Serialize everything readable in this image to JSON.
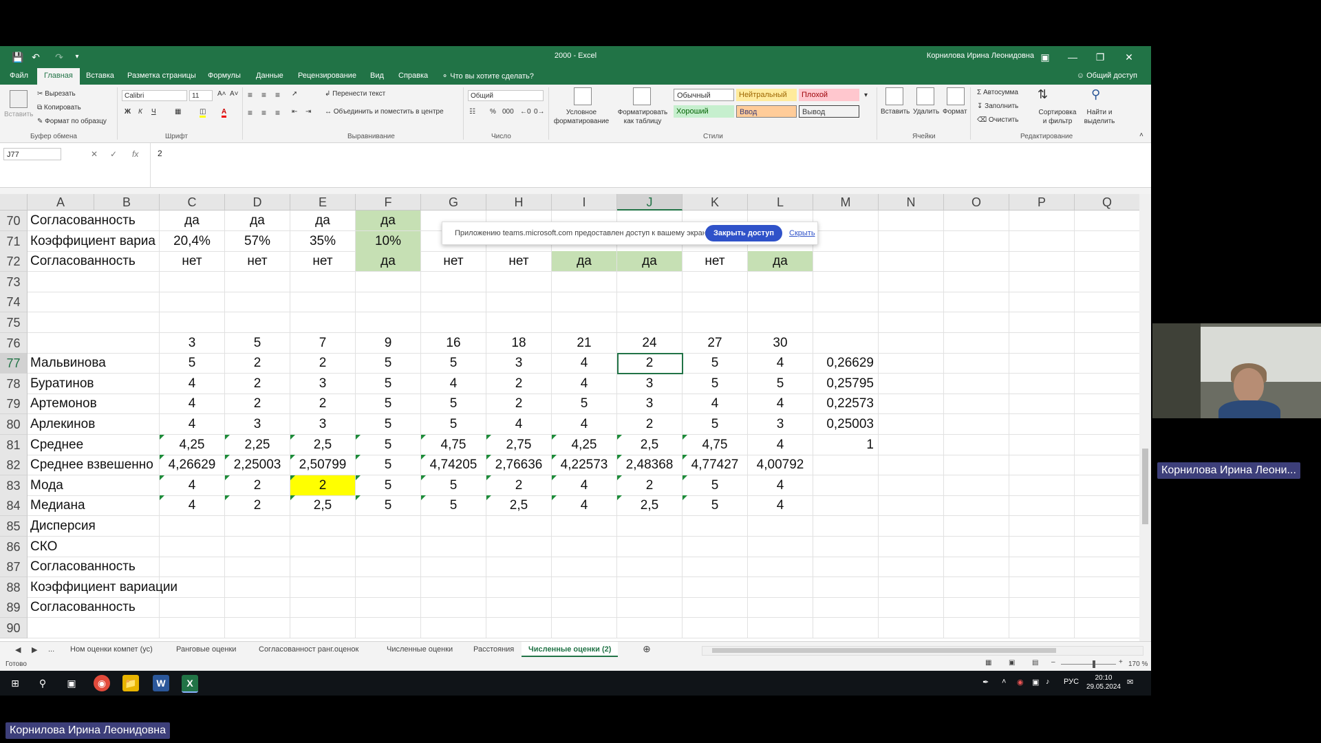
{
  "excel": {
    "title": "2000  -  Excel",
    "user": "Корнилова Ирина Леонидовна",
    "quick_access": {
      "save_icon": "save-icon",
      "undo_icon": "undo-icon",
      "redo_icon": "redo-icon"
    },
    "menu": [
      "Файл",
      "Главная",
      "Вставка",
      "Разметка страницы",
      "Формулы",
      "Данные",
      "Рецензирование",
      "Вид",
      "Справка",
      "Что вы хотите сделать?"
    ],
    "share_label": "Общий доступ",
    "ribbon": {
      "paste": "Вставить",
      "cut": "Вырезать",
      "copy": "Копировать",
      "format_painter": "Формат по образцу",
      "clipboard_group": "Буфер обмена",
      "font_name": "Calibri",
      "font_size": "11",
      "bold": "Ж",
      "italic": "К",
      "underline": "Ч",
      "font_group": "Шрифт",
      "wrap_text": "Перенести текст",
      "merge_center": "Объединить и поместить в центре",
      "alignment_group": "Выравнивание",
      "number_format": "Общий",
      "number_group": "Число",
      "conditional_formatting": [
        "Условное",
        "форматирование"
      ],
      "format_as_table": [
        "Форматировать",
        "как таблицу"
      ],
      "styles": [
        "Обычный",
        "Нейтральный",
        "Плохой",
        "Хороший",
        "Ввод",
        "Вывод"
      ],
      "styles_group": "Стили",
      "insert": "Вставить",
      "delete": "Удалить",
      "format": "Формат",
      "cells_group": "Ячейки",
      "autosum": "Автосумма",
      "fill": "Заполнить",
      "clear": "Очистить",
      "sort_filter": [
        "Сортировка",
        "и фильтр"
      ],
      "find_select": [
        "Найти и",
        "выделить"
      ],
      "editing_group": "Редактирование"
    },
    "formula_bar": {
      "name_box": "J77",
      "fx": "fx",
      "formula": "2"
    },
    "columns": [
      "A",
      "B",
      "C",
      "D",
      "E",
      "F",
      "G",
      "H",
      "I",
      "J",
      "K",
      "L",
      "M",
      "N",
      "O",
      "P",
      "Q"
    ],
    "selected_column": "J",
    "rows": [
      {
        "n": "70",
        "cells": {
          "A": "Согласованность",
          "C": "да",
          "D": "да",
          "E": "да",
          "F": "да"
        }
      },
      {
        "n": "71",
        "cells": {
          "A": "Коэффициент вариа",
          "C": "20,4%",
          "D": "57%",
          "E": "35%",
          "F": "10%"
        }
      },
      {
        "n": "72",
        "cells": {
          "A": "Согласованность",
          "C": "нет",
          "D": "нет",
          "E": "нет",
          "F": "да",
          "G": "нет",
          "H": "нет",
          "I": "да",
          "J": "да",
          "K": "нет",
          "L": "да"
        }
      },
      {
        "n": "73",
        "cells": {}
      },
      {
        "n": "74",
        "cells": {}
      },
      {
        "n": "75",
        "cells": {}
      },
      {
        "n": "76",
        "cells": {
          "C": "3",
          "D": "5",
          "E": "7",
          "F": "9",
          "G": "16",
          "H": "18",
          "I": "21",
          "J": "24",
          "K": "27",
          "L": "30"
        }
      },
      {
        "n": "77",
        "cells": {
          "A": "Мальвинова",
          "C": "5",
          "D": "2",
          "E": "2",
          "F": "5",
          "G": "5",
          "H": "3",
          "I": "4",
          "J": "2",
          "K": "5",
          "L": "4",
          "M": "0,26629"
        }
      },
      {
        "n": "78",
        "cells": {
          "A": "Буратинов",
          "C": "4",
          "D": "2",
          "E": "3",
          "F": "5",
          "G": "4",
          "H": "2",
          "I": "4",
          "J": "3",
          "K": "5",
          "L": "5",
          "M": "0,25795"
        }
      },
      {
        "n": "79",
        "cells": {
          "A": "Артемонов",
          "C": "4",
          "D": "2",
          "E": "2",
          "F": "5",
          "G": "5",
          "H": "2",
          "I": "5",
          "J": "3",
          "K": "4",
          "L": "4",
          "M": "0,22573"
        }
      },
      {
        "n": "80",
        "cells": {
          "A": "Арлекинов",
          "C": "4",
          "D": "3",
          "E": "3",
          "F": "5",
          "G": "5",
          "H": "4",
          "I": "4",
          "J": "2",
          "K": "5",
          "L": "3",
          "M": "0,25003"
        }
      },
      {
        "n": "81",
        "cells": {
          "A": "Среднее",
          "C": "4,25",
          "D": "2,25",
          "E": "2,5",
          "F": "5",
          "G": "4,75",
          "H": "2,75",
          "I": "4,25",
          "J": "2,5",
          "K": "4,75",
          "L": "4",
          "M": "1"
        }
      },
      {
        "n": "82",
        "cells": {
          "A": "Среднее взвешенно",
          "C": "4,26629",
          "D": "2,25003",
          "E": "2,50799",
          "F": "5",
          "G": "4,74205",
          "H": "2,76636",
          "I": "4,22573",
          "J": "2,48368",
          "K": "4,77427",
          "L": "4,00792"
        }
      },
      {
        "n": "83",
        "cells": {
          "A": "Мода",
          "C": "4",
          "D": "2",
          "E": "2",
          "F": "5",
          "G": "5",
          "H": "2",
          "I": "4",
          "J": "2",
          "K": "5",
          "L": "4"
        }
      },
      {
        "n": "84",
        "cells": {
          "A": "Медиана",
          "C": "4",
          "D": "2",
          "E": "2,5",
          "F": "5",
          "G": "5",
          "H": "2,5",
          "I": "4",
          "J": "2,5",
          "K": "5",
          "L": "4"
        }
      },
      {
        "n": "85",
        "cells": {
          "A": "Дисперсия"
        }
      },
      {
        "n": "86",
        "cells": {
          "A": "СКО"
        }
      },
      {
        "n": "87",
        "cells": {
          "A": "Согласованность"
        }
      },
      {
        "n": "88",
        "cells": {
          "A": "Коэффициент вариации"
        }
      },
      {
        "n": "89",
        "cells": {
          "A": "Согласованность"
        }
      },
      {
        "n": "90",
        "cells": {}
      }
    ],
    "active_cell": {
      "col": "J",
      "row": "77"
    },
    "sheet_tabs": [
      "Ном оценки компет (ус)",
      "Ранговые оценки",
      "Согласованност ранг.оценок",
      "Численные оценки",
      "Расстояния",
      "Численные оценки (2)"
    ],
    "active_sheet": "Численные оценки (2)",
    "tabs_more": "...",
    "add_sheet_icon": "plus-icon",
    "status": "Готово",
    "zoom": "170 %"
  },
  "notification": {
    "text": "Приложению teams.microsoft.com предоставлен доступ к вашему экрану.",
    "stop_button": "Закрыть доступ",
    "hide_link": "Скрыть"
  },
  "taskbar": {
    "apps": [
      "start-icon",
      "search-icon",
      "task-view-icon",
      "chrome-icon",
      "file-explorer-icon",
      "word-icon",
      "excel-icon"
    ],
    "language": "РУС",
    "time": "20:10",
    "date": "29.05.2024"
  },
  "participant": {
    "name": "Корнилова Ирина Леони..."
  },
  "presenter": {
    "name": "Корнилова Ирина Леонидовна"
  },
  "colors": {
    "excel_green": "#217346",
    "consistent_fill": "#c6e0b4",
    "highlight_fill": "#ffff00",
    "teams_purple": "#3d3f7a",
    "teams_blue": "#2f52c9"
  }
}
